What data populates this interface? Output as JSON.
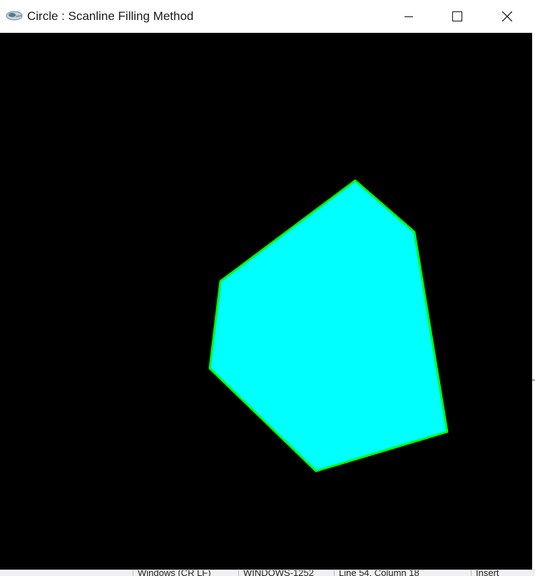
{
  "window": {
    "title": "Circle : Scanline Filling Method",
    "icon": "opengl-app-icon",
    "controls": [
      "minimize-icon",
      "maximize-icon",
      "close-icon"
    ]
  },
  "canvas": {
    "background": "#000000",
    "fill_color": "#00ffff",
    "edge_color": "#00ff00"
  },
  "statusbar": {
    "line_ending": "Windows (CR LF)",
    "encoding": "WINDOWS-1252",
    "position": "Line 54, Column 18",
    "mode": "Insert"
  }
}
